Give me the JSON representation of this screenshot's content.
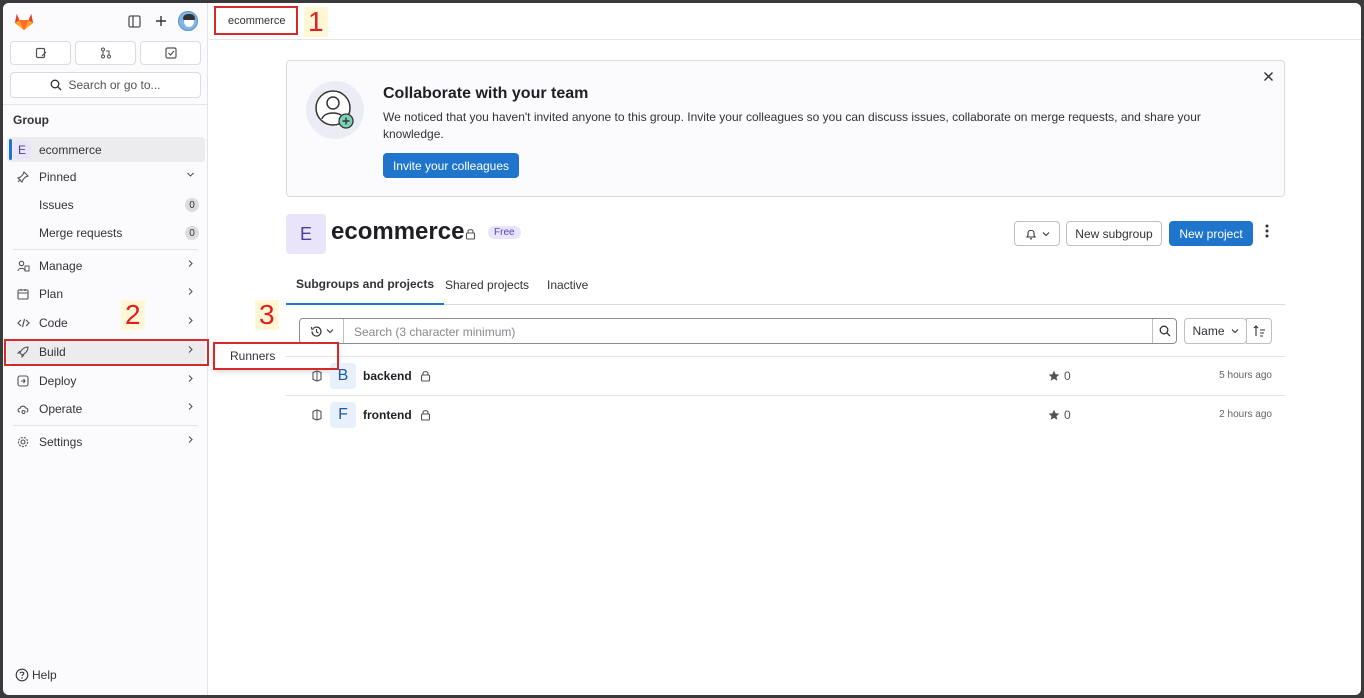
{
  "sidebar": {
    "search_label": "Search or go to...",
    "section_label": "Group",
    "group": {
      "initial": "E",
      "name": "ecommerce"
    },
    "pinned": {
      "label": "Pinned",
      "items": [
        {
          "label": "Issues",
          "count": "0"
        },
        {
          "label": "Merge requests",
          "count": "0"
        }
      ]
    },
    "nav": [
      {
        "label": "Manage"
      },
      {
        "label": "Plan"
      },
      {
        "label": "Code"
      },
      {
        "label": "Build"
      },
      {
        "label": "Deploy"
      },
      {
        "label": "Operate"
      }
    ],
    "settings_label": "Settings",
    "help_label": "Help",
    "flyout": {
      "label": "Runners"
    }
  },
  "annotations": {
    "one": "1",
    "two": "2",
    "three": "3"
  },
  "breadcrumb": {
    "label": "ecommerce"
  },
  "banner": {
    "title": "Collaborate with your team",
    "text": "We noticed that you haven't invited anyone to this group. Invite your colleagues so you can discuss issues, collaborate on merge requests, and share your knowledge.",
    "button": "Invite your colleagues"
  },
  "group_header": {
    "initial": "E",
    "title": "ecommerce",
    "badge": "Free",
    "new_subgroup": "New subgroup",
    "new_project": "New project"
  },
  "tabs": [
    {
      "label": "Subgroups and projects"
    },
    {
      "label": "Shared projects"
    },
    {
      "label": "Inactive"
    }
  ],
  "filter": {
    "placeholder": "Search (3 character minimum)",
    "sort_label": "Name"
  },
  "projects": [
    {
      "initial": "B",
      "name": "backend",
      "stars": "0",
      "updated": "5 hours ago"
    },
    {
      "initial": "F",
      "name": "frontend",
      "stars": "0",
      "updated": "2 hours ago"
    }
  ],
  "colors": {
    "accent": "#1f75cb",
    "annotation_red": "#d42a2a",
    "group_avatar_bg": "#e9e4fa"
  }
}
